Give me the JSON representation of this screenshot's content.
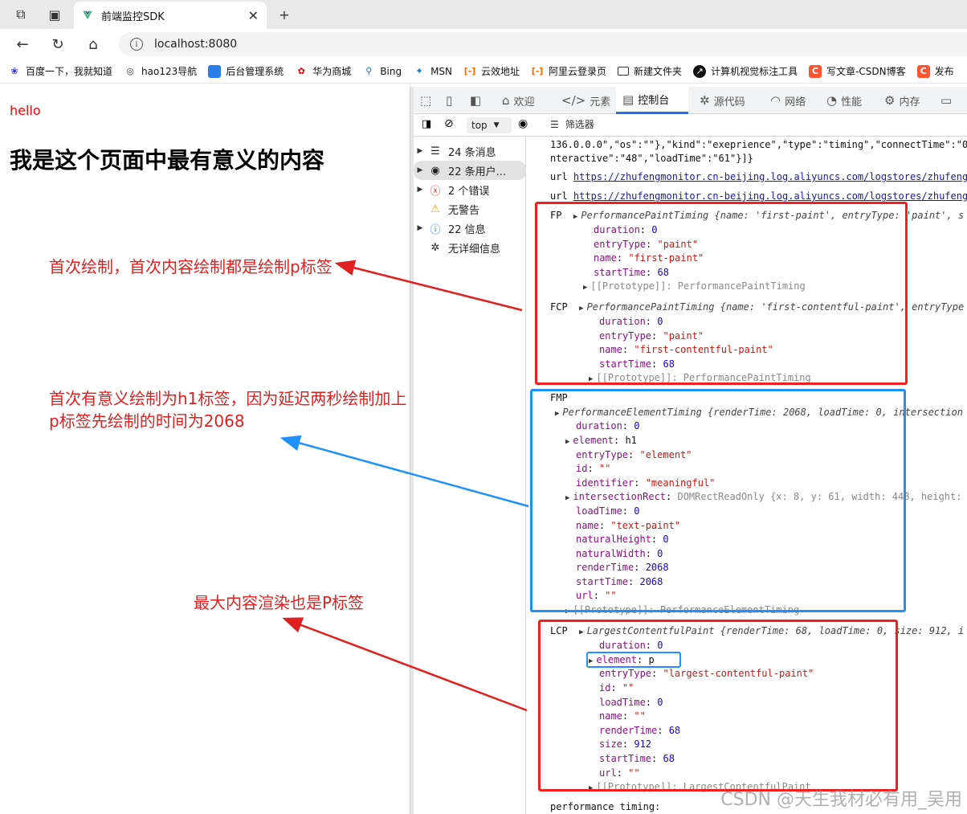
{
  "browser": {
    "tab_title": "前端监控SDK",
    "url": "localhost:8080",
    "bookmarks": [
      "百度一下，我就知道",
      "hao123导航",
      "后台管理系统",
      "华为商城",
      "Bing",
      "MSN",
      "云效地址",
      "阿里云登录页",
      "新建文件夹",
      "计算机视觉标注工具",
      "写文章-CSDN博客",
      "发布"
    ]
  },
  "page": {
    "hello": "hello",
    "heading": "我是这个页面中最有意义的内容"
  },
  "annotations": {
    "a1": "首次绘制，首次内容绘制都是绘制p标签",
    "a2_line1": "首次有意义绘制为h1标签，因为延迟两秒绘制加上",
    "a2_line2": "p标签先绘制的时间为2068",
    "a3": "最大内容渲染也是P标签"
  },
  "devtools": {
    "tabs": [
      "欢迎",
      "元素",
      "控制台",
      "源代码",
      "网络",
      "性能",
      "内存"
    ],
    "active_tab": "控制台",
    "context": "top",
    "filter_label": "筛选器",
    "sidebar": [
      "24 条消息",
      "22 条用户...",
      "2 个错误",
      "无警告",
      "22 信息",
      "无详细信息"
    ]
  },
  "console": {
    "l1": "136.0.0.0\",\"os\":\"\"},\"kind\":\"exeprience\",\"type\":\"timing\",\"connectTime\":\"0",
    "l2": "nteractive\":\"48\",\"loadTime\":\"61\"}]}",
    "url_label": "url",
    "url_link": "https://zhufengmonitor.cn-beijing.log.aliyuncs.com/logstores/zhufeng",
    "fp": {
      "label": "FP",
      "summary_type": "PerformancePaintTiming",
      "summary": "{name: 'first-paint', entryType: 'paint', s",
      "rows": [
        [
          "duration",
          "0"
        ],
        [
          "entryType",
          "\"paint\""
        ],
        [
          "name",
          "\"first-paint\""
        ],
        [
          "startTime",
          "68"
        ]
      ],
      "proto": "[[Prototype]]: PerformancePaintTiming"
    },
    "fcp": {
      "label": "FCP",
      "summary_type": "PerformancePaintTiming",
      "summary": "{name: 'first-contentful-paint', entryType",
      "rows": [
        [
          "duration",
          "0"
        ],
        [
          "entryType",
          "\"paint\""
        ],
        [
          "name",
          "\"first-contentful-paint\""
        ],
        [
          "startTime",
          "68"
        ]
      ],
      "proto": "[[Prototype]]: PerformancePaintTiming"
    },
    "fmp": {
      "label": "FMP",
      "summary_type": "PerformanceElementTiming",
      "summary": "{renderTime: 2068, loadTime: 0, intersection",
      "rows": [
        [
          "duration",
          "0"
        ],
        [
          "element",
          "h1"
        ],
        [
          "entryType",
          "\"element\""
        ],
        [
          "id",
          "\"\""
        ],
        [
          "identifier",
          "\"meaningful\""
        ],
        [
          "intersectionRect",
          "DOMRectReadOnly {x: 8, y: 61, width: 448, height:"
        ],
        [
          "loadTime",
          "0"
        ],
        [
          "name",
          "\"text-paint\""
        ],
        [
          "naturalHeight",
          "0"
        ],
        [
          "naturalWidth",
          "0"
        ],
        [
          "renderTime",
          "2068"
        ],
        [
          "startTime",
          "2068"
        ],
        [
          "url",
          "\"\""
        ]
      ],
      "proto": "[[Prototype]]: PerformanceElementTiming"
    },
    "lcp": {
      "label": "LCP",
      "summary_type": "LargestContentfulPaint",
      "summary": "{renderTime: 68, loadTime: 0, size: 912, i",
      "rows": [
        [
          "duration",
          "0"
        ],
        [
          "element",
          "p"
        ],
        [
          "entryType",
          "\"largest-contentful-paint\""
        ],
        [
          "id",
          "\"\""
        ],
        [
          "loadTime",
          "0"
        ],
        [
          "name",
          "\"\""
        ],
        [
          "renderTime",
          "68"
        ],
        [
          "size",
          "912"
        ],
        [
          "startTime",
          "68"
        ],
        [
          "url",
          "\"\""
        ]
      ],
      "proto": "[[Prototype]]: LargestContentfulPaint"
    },
    "last": "performance timing:"
  },
  "watermark": "CSDN @天生我材必有用_吴用",
  "colors": {
    "annotation_red": "#e02020",
    "box_red": "#f02020",
    "box_blue": "#1e90ff",
    "link": "#1a1aa6"
  }
}
